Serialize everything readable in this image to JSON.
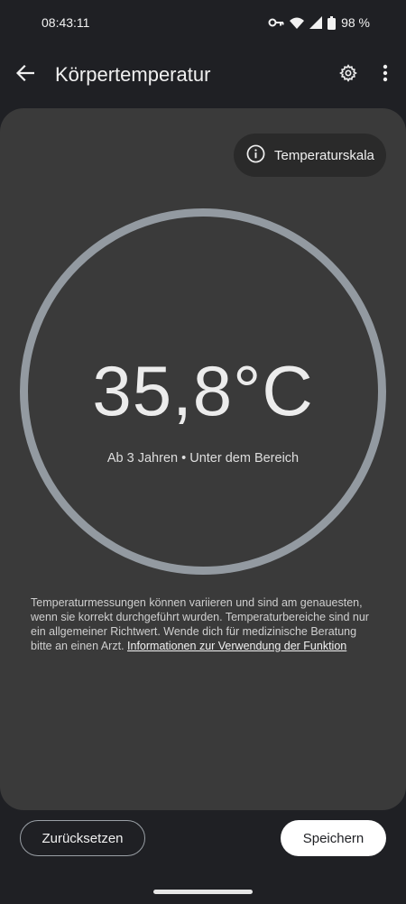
{
  "status_bar": {
    "time": "08:43:11",
    "battery": "98 %",
    "icons": [
      "vpn-key-icon",
      "wifi-icon",
      "signal-icon",
      "battery-icon"
    ]
  },
  "app_bar": {
    "title": "Körpertemperatur",
    "icons": [
      "back-arrow-icon",
      "gear-icon",
      "more-vert-icon"
    ]
  },
  "card": {
    "scale_button": "Temperaturskala",
    "temperature": "35,8°C",
    "subtitle": "Ab 3 Jahren • Unter dem Bereich",
    "disclaimer": "Temperaturmessungen können variieren und sind am genauesten, wenn sie korrekt durchgeführt wurden. Temperaturbereiche sind nur ein allgemeiner Richtwert. Wende dich für medizinische Beratung bitte an einen Arzt.",
    "info_link": "Informationen zur Verwendung der Funktion"
  },
  "actions": {
    "reset": "Zurücksetzen",
    "save": "Speichern"
  },
  "colors": {
    "background": "#1f2024",
    "card": "#3a3a3a",
    "ring": "#939aa1",
    "save_button": "#ffffff"
  }
}
